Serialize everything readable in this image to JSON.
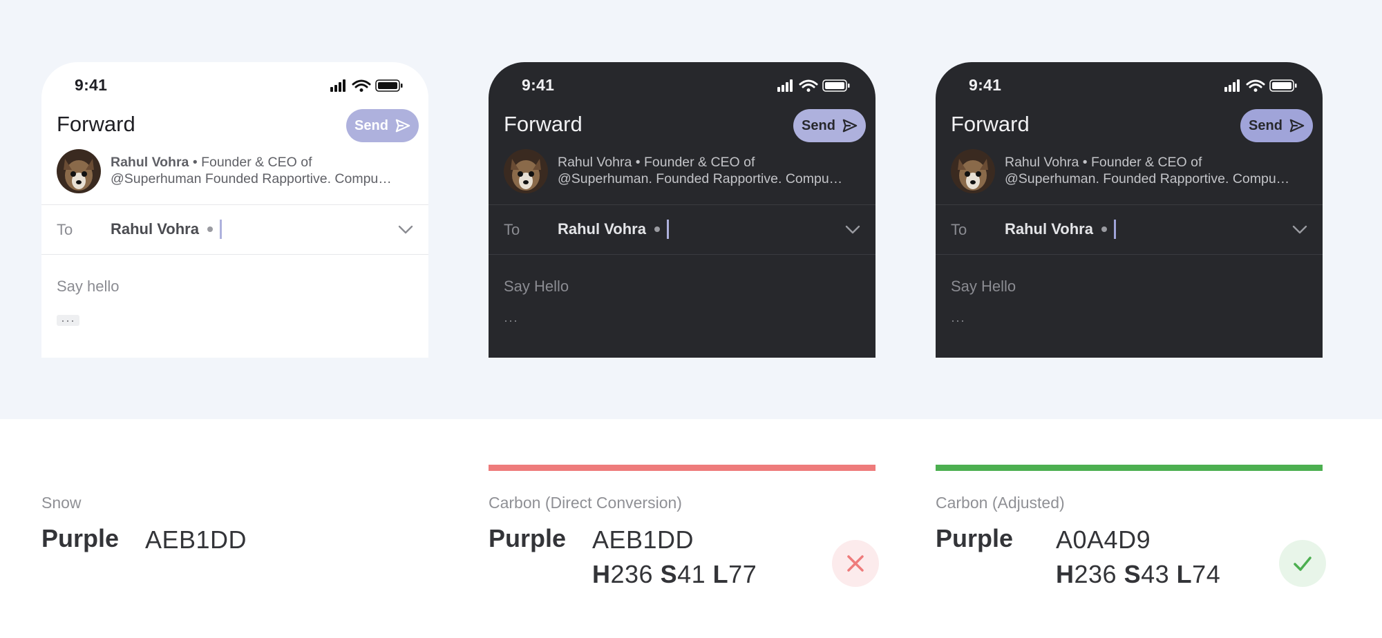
{
  "phones": [
    {
      "theme": "Snow",
      "time": "9:41",
      "title": "Forward",
      "send_label": "Send",
      "sender_name": "Rahul Vohra",
      "bio_line1": "• Founder & CEO of",
      "bio_line2": "@Superhuman Founded Rapportive. Compu…",
      "to_label": "To",
      "recipient": "Rahul Vohra",
      "body_placeholder": "Say hello",
      "quoted_toggle": "···"
    },
    {
      "theme": "Carbon (Direct Conversion)",
      "time": "9:41",
      "title": "Forward",
      "send_label": "Send",
      "sender_name": "Rahul Vohra",
      "bio_line1": "• Founder & CEO of",
      "bio_line2": "@Superhuman. Founded Rapportive. Compu…",
      "to_label": "To",
      "recipient": "Rahul Vohra",
      "body_placeholder": "Say Hello",
      "quoted_toggle": "···"
    },
    {
      "theme": "Carbon (Adjusted)",
      "time": "9:41",
      "title": "Forward",
      "send_label": "Send",
      "sender_name": "Rahul Vohra",
      "bio_line1": "• Founder & CEO of",
      "bio_line2": "@Superhuman. Founded Rapportive. Compu…",
      "to_label": "To",
      "recipient": "Rahul Vohra",
      "body_placeholder": "Say Hello",
      "quoted_toggle": "···"
    }
  ],
  "swatches": [
    {
      "caption": "Snow",
      "label": "Purple",
      "hex": "AEB1DD",
      "color": "#AEB1DD"
    },
    {
      "caption": "Carbon (Direct Conversion)",
      "label": "Purple",
      "hex": "AEB1DD",
      "h": "236",
      "s": "41",
      "l": "77",
      "color": "#AEB1DD",
      "verdict": "fail",
      "indicator_color": "#EE7B7B"
    },
    {
      "caption": "Carbon (Adjusted)",
      "label": "Purple",
      "hex": "A0A4D9",
      "h": "236",
      "s": "43",
      "l": "74",
      "color": "#A0A4D9",
      "verdict": "pass",
      "indicator_color": "#4CAF50"
    }
  ],
  "hsl_letters": {
    "h": "H",
    "s": "S",
    "l": "L"
  },
  "icons": [
    "signal-icon",
    "wifi-icon",
    "battery-icon",
    "send-arrow-icon",
    "chevron-down-icon",
    "close-icon",
    "check-icon"
  ]
}
